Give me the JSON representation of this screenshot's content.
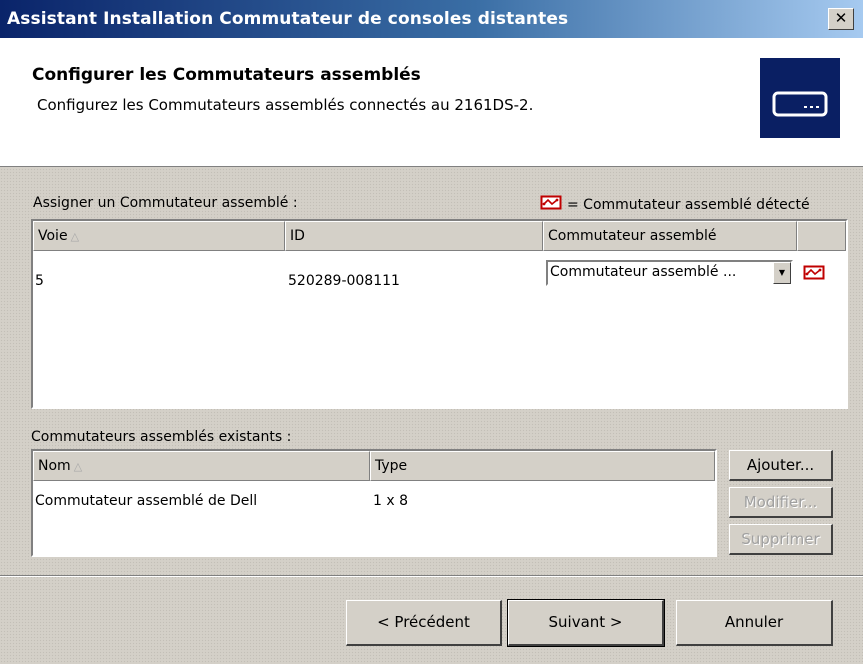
{
  "window": {
    "title": "Assistant Installation Commutateur de consoles distantes",
    "close_glyph": "✕"
  },
  "header": {
    "title": "Configurer les Commutateurs assemblés",
    "subtitle": "Configurez les Commutateurs assemblés connectés au 2161DS-2.",
    "icon": "switch-device-icon",
    "icon_bg": "#0a1f63"
  },
  "assign": {
    "label": "Assigner un Commutateur assemblé :",
    "legend_text": "= Commutateur assemblé détecté",
    "legend_icon": "detected-switch-icon",
    "columns": [
      "Voie",
      "ID",
      "Commutateur assemblé",
      ""
    ],
    "sorted_column": "Voie",
    "rows": [
      {
        "voie": "5",
        "id": "520289-008111",
        "switch": "Commutateur assemblé ...",
        "detected": true
      }
    ]
  },
  "existing": {
    "label": "Commutateurs assemblés existants :",
    "columns": [
      "Nom",
      "Type"
    ],
    "sorted_column": "Nom",
    "rows": [
      {
        "nom": "Commutateur assemblé de Dell",
        "type": "1 x 8"
      }
    ],
    "buttons": {
      "add": "Ajouter...",
      "modify": "Modifier...",
      "delete": "Supprimer"
    }
  },
  "footer": {
    "prev": "< Précédent",
    "next": "Suivant >",
    "cancel": "Annuler"
  },
  "colors": {
    "accent": "#0a246a",
    "detect_icon": "#c00000",
    "face": "#d4d0c8"
  }
}
